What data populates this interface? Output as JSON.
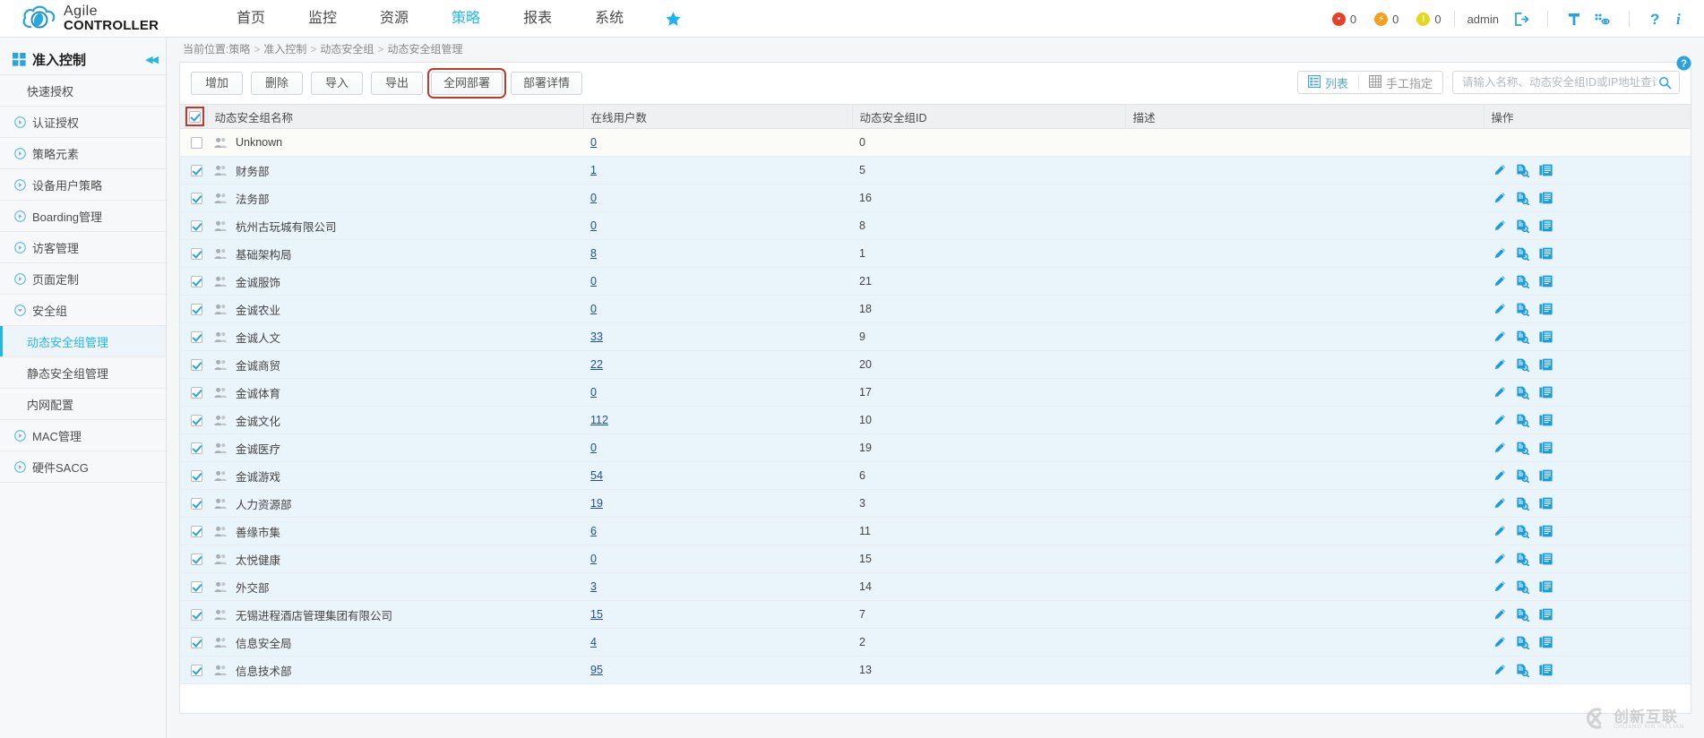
{
  "brand": {
    "line1": "Agile",
    "line2": "CONTROLLER",
    "logo_icon": "cloud-logo-icon"
  },
  "header": {
    "nav": [
      {
        "label": "首页",
        "active": false
      },
      {
        "label": "监控",
        "active": false
      },
      {
        "label": "资源",
        "active": false
      },
      {
        "label": "策略",
        "active": true
      },
      {
        "label": "报表",
        "active": false
      },
      {
        "label": "系统",
        "active": false
      }
    ],
    "star_icon": "star-icon",
    "alarms": [
      {
        "icon": "critical-alarm-icon",
        "color": "#e8402a",
        "count": "0"
      },
      {
        "icon": "major-alarm-icon",
        "color": "#f2a01e",
        "count": "0"
      },
      {
        "icon": "minor-alarm-icon",
        "color": "#e3d820",
        "count": "0"
      }
    ],
    "user": "admin",
    "icons": [
      "logout-icon",
      "filter-icon",
      "monitor-eye-icon",
      "help-icon",
      "info-icon"
    ]
  },
  "sidebar": {
    "title": "准入控制",
    "title_icon": "grid-icon",
    "collapse_icon": "collapse-left-icon",
    "items": [
      {
        "label": "快速授权",
        "icon": "",
        "child": true,
        "selected": false
      },
      {
        "label": "认证授权",
        "icon": "expand-circle-icon",
        "child": false,
        "selected": false
      },
      {
        "label": "策略元素",
        "icon": "expand-circle-icon",
        "child": false,
        "selected": false
      },
      {
        "label": "设备用户策略",
        "icon": "expand-circle-icon",
        "child": false,
        "selected": false
      },
      {
        "label": "Boarding管理",
        "icon": "expand-circle-icon",
        "child": false,
        "selected": false
      },
      {
        "label": "访客管理",
        "icon": "expand-circle-icon",
        "child": false,
        "selected": false
      },
      {
        "label": "页面定制",
        "icon": "expand-circle-icon",
        "child": false,
        "selected": false
      },
      {
        "label": "安全组",
        "icon": "collapse-circle-icon",
        "child": false,
        "selected": false
      },
      {
        "label": "动态安全组管理",
        "icon": "",
        "child": true,
        "selected": true
      },
      {
        "label": "静态安全组管理",
        "icon": "",
        "child": true,
        "selected": false
      },
      {
        "label": "内网配置",
        "icon": "",
        "child": true,
        "selected": false
      },
      {
        "label": "MAC管理",
        "icon": "expand-circle-icon",
        "child": false,
        "selected": false
      },
      {
        "label": "硬件SACG",
        "icon": "expand-circle-icon",
        "child": false,
        "selected": false
      }
    ]
  },
  "breadcrumb": {
    "prefix": "当前位置:",
    "path": [
      "策略",
      "准入控制",
      "动态安全组",
      "动态安全组管理"
    ],
    "separator": ">"
  },
  "toolbar": {
    "buttons": [
      {
        "label": "增加",
        "highlighted": false
      },
      {
        "label": "删除",
        "highlighted": false
      },
      {
        "label": "导入",
        "highlighted": false
      },
      {
        "label": "导出",
        "highlighted": false
      },
      {
        "label": "全网部署",
        "highlighted": true
      },
      {
        "label": "部署详情",
        "highlighted": false
      }
    ],
    "view_list": "列表",
    "view_manual": "手工指定",
    "list_icon": "list-view-icon",
    "manual_icon": "table-grid-icon",
    "search_placeholder": "请输入名称、动态安全组ID或IP地址查询",
    "search_value": "",
    "search_icon": "search-icon"
  },
  "table": {
    "columns": [
      "动态安全组名称",
      "在线用户数",
      "动态安全组ID",
      "描述",
      "操作"
    ],
    "header_checkbox_checked": true,
    "op_icons": [
      "edit-pencil-icon",
      "view-detail-icon",
      "copy-list-icon"
    ],
    "row_icon": "user-group-icon",
    "rows": [
      {
        "checked": false,
        "name": "Unknown",
        "users": "0",
        "id": "0",
        "desc": "",
        "ops": false
      },
      {
        "checked": true,
        "name": "财务部",
        "users": "1",
        "id": "5",
        "desc": "",
        "ops": true
      },
      {
        "checked": true,
        "name": "法务部",
        "users": "0",
        "id": "16",
        "desc": "",
        "ops": true
      },
      {
        "checked": true,
        "name": "杭州古玩城有限公司",
        "users": "0",
        "id": "8",
        "desc": "",
        "ops": true
      },
      {
        "checked": true,
        "name": "基础架构局",
        "users": "8",
        "id": "1",
        "desc": "",
        "ops": true
      },
      {
        "checked": true,
        "name": "金诚服饰",
        "users": "0",
        "id": "21",
        "desc": "",
        "ops": true
      },
      {
        "checked": true,
        "name": "金诚农业",
        "users": "0",
        "id": "18",
        "desc": "",
        "ops": true
      },
      {
        "checked": true,
        "name": "金诚人文",
        "users": "33",
        "id": "9",
        "desc": "",
        "ops": true
      },
      {
        "checked": true,
        "name": "金诚商贸",
        "users": "22",
        "id": "20",
        "desc": "",
        "ops": true
      },
      {
        "checked": true,
        "name": "金诚体育",
        "users": "0",
        "id": "17",
        "desc": "",
        "ops": true
      },
      {
        "checked": true,
        "name": "金诚文化",
        "users": "112",
        "id": "10",
        "desc": "",
        "ops": true
      },
      {
        "checked": true,
        "name": "金诚医疗",
        "users": "0",
        "id": "19",
        "desc": "",
        "ops": true
      },
      {
        "checked": true,
        "name": "金诚游戏",
        "users": "54",
        "id": "6",
        "desc": "",
        "ops": true
      },
      {
        "checked": true,
        "name": "人力资源部",
        "users": "19",
        "id": "3",
        "desc": "",
        "ops": true
      },
      {
        "checked": true,
        "name": "善缘市集",
        "users": "6",
        "id": "11",
        "desc": "",
        "ops": true
      },
      {
        "checked": true,
        "name": "太悦健康",
        "users": "0",
        "id": "15",
        "desc": "",
        "ops": true
      },
      {
        "checked": true,
        "name": "外交部",
        "users": "3",
        "id": "14",
        "desc": "",
        "ops": true
      },
      {
        "checked": true,
        "name": "无锡进程酒店管理集团有限公司",
        "users": "15",
        "id": "7",
        "desc": "",
        "ops": true
      },
      {
        "checked": true,
        "name": "信息安全局",
        "users": "4",
        "id": "2",
        "desc": "",
        "ops": true
      },
      {
        "checked": true,
        "name": "信息技术部",
        "users": "95",
        "id": "13",
        "desc": "",
        "ops": true
      }
    ]
  },
  "watermark": {
    "icon": "cx-logo-icon",
    "cn": "创新互联",
    "en": "CHUANG XIN HU LIAN"
  },
  "colors": {
    "accent": "#23b7e5",
    "link": "#1e4fa3",
    "highlight_box": "#c0392b",
    "row_bg": "#eaf4fb"
  }
}
